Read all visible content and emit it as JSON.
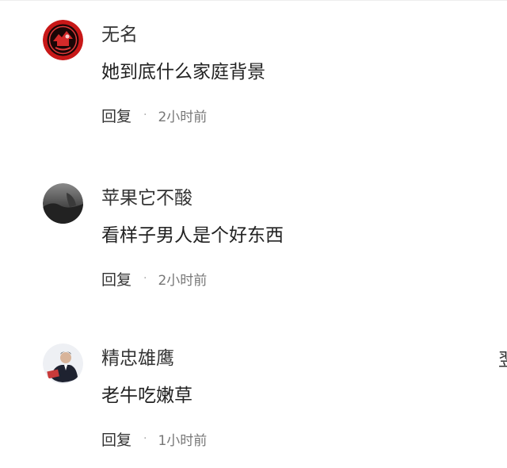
{
  "comments": [
    {
      "username": "无名",
      "text": "她到底什么家庭背景",
      "reply_label": "回复",
      "separator": "·",
      "time": "2小时前",
      "avatar_icon": "red-emblem-avatar"
    },
    {
      "username": "苹果它不酸",
      "text": "看样子男人是个好东西",
      "reply_label": "回复",
      "separator": "·",
      "time": "2小时前",
      "avatar_icon": "dark-landscape-avatar"
    },
    {
      "username": "精忠雄鹰",
      "text": "老牛吃嫩草",
      "reply_label": "回复",
      "separator": "·",
      "time": "1小时前",
      "avatar_icon": "person-photo-avatar",
      "edge_text": "翌"
    }
  ],
  "colors": {
    "avatar_red": "#c81818",
    "text": "#222222",
    "meta": "#777777"
  }
}
